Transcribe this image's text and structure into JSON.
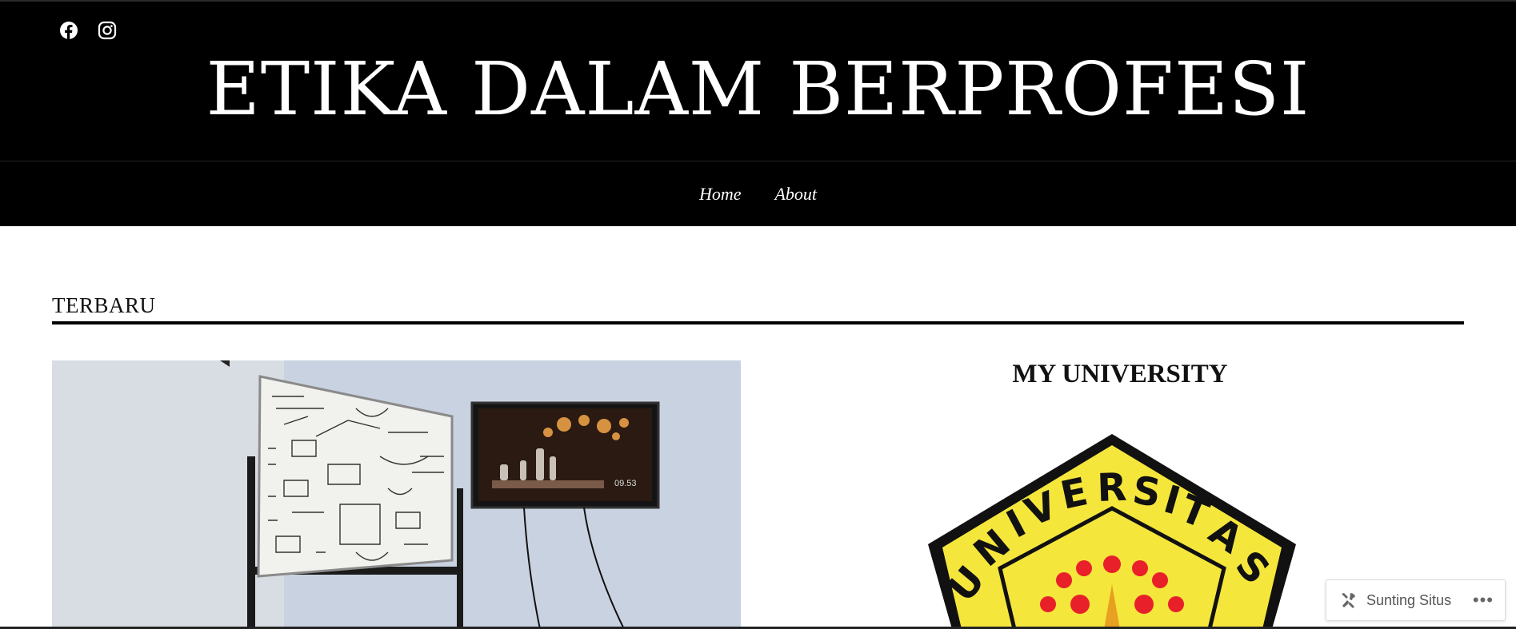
{
  "header": {
    "social": [
      {
        "icon": "facebook-icon"
      },
      {
        "icon": "instagram-icon"
      }
    ],
    "site_title": "ETIKA DALAM BERPROFESI"
  },
  "nav": {
    "items": [
      {
        "label": "Home"
      },
      {
        "label": "About"
      }
    ]
  },
  "main": {
    "section_title": "TERBARU",
    "featured_image": {
      "alt_icon": "whiteboard-photo",
      "tv_time": "09.53"
    }
  },
  "sidebar": {
    "widget_title": "MY UNIVERSITY",
    "logo": {
      "text": "UNIVERSITAS",
      "colors": {
        "yellow": "#f5e63c",
        "red": "#e8202a",
        "black": "#111111"
      }
    }
  },
  "edit_bar": {
    "icon": "tools-icon",
    "label": "Sunting Situs",
    "more_icon": "more-dots-icon",
    "more_label": "•••"
  }
}
